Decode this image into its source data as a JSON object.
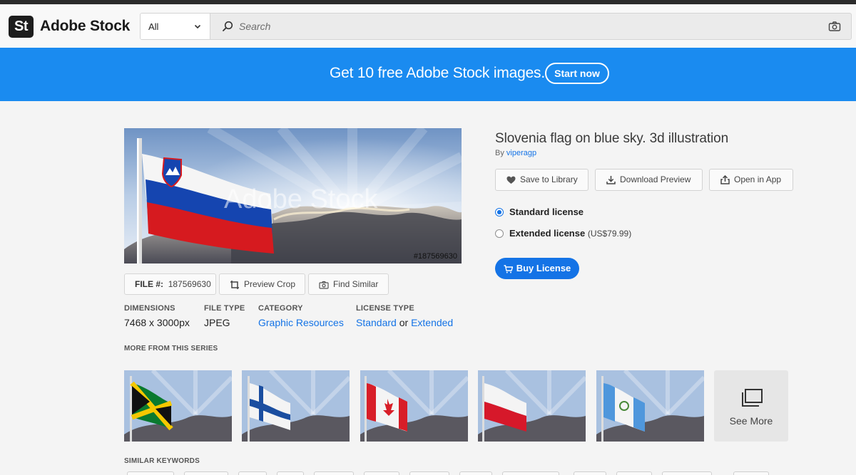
{
  "header": {
    "logo_mark": "St",
    "logo_text": "Adobe Stock",
    "scope_value": "All",
    "search_placeholder": "Search"
  },
  "promo": {
    "text": "Get 10 free Adobe Stock images.",
    "button": "Start now",
    "color": "#1a8bf0"
  },
  "asset": {
    "title": "Slovenia flag on blue sky. 3d illustration",
    "by_prefix": "By",
    "author": "viperagp",
    "watermark": "Adobe Stock",
    "image_file_tag": "#187569630",
    "file_label": "FILE #:",
    "file_number": "187569630",
    "preview_crop": "Preview Crop",
    "find_similar": "Find Similar"
  },
  "meta": {
    "dimensions_label": "DIMENSIONS",
    "dimensions_value": "7468 x 3000px",
    "filetype_label": "FILE TYPE",
    "filetype_value": "JPEG",
    "category_label": "CATEGORY",
    "category_value": "Graphic Resources",
    "license_label": "LICENSE TYPE",
    "license_standard": "Standard",
    "license_or": "or",
    "license_extended": "Extended"
  },
  "actions": {
    "save": "Save to Library",
    "download": "Download Preview",
    "open": "Open in App"
  },
  "licenses": {
    "standard": "Standard license",
    "extended": "Extended license",
    "extended_price": "(US$79.99)",
    "selected": "standard"
  },
  "buy": {
    "label": "Buy License",
    "color": "#1473e6"
  },
  "series": {
    "heading": "MORE FROM THIS SERIES",
    "flags": [
      "Jamaica",
      "Finland",
      "Canada",
      "Poland",
      "Guatemala"
    ],
    "see_more": "See More"
  },
  "keywords": {
    "heading": "SIMILAR KEYWORDS"
  }
}
